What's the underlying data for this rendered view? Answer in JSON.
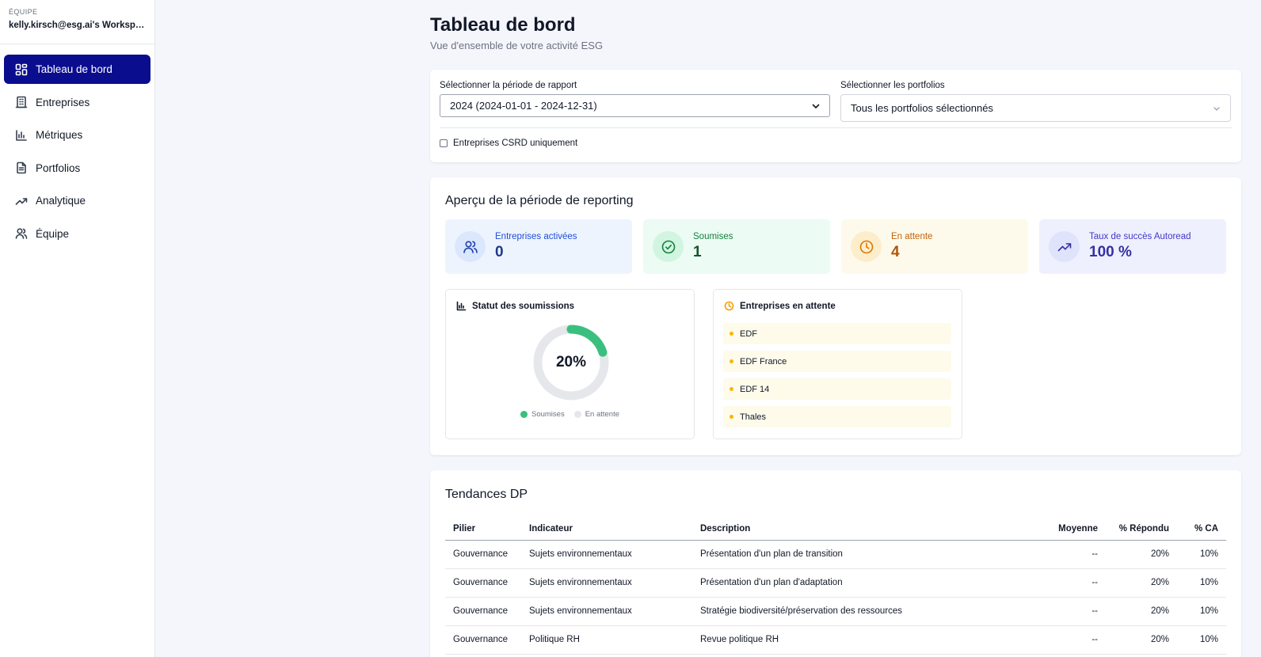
{
  "sidebar": {
    "team_caption": "ÉQUIPE",
    "team_name": "kelly.kirsch@esg.ai's Workspace",
    "items": [
      {
        "label": "Tableau de bord",
        "icon": "dashboard-icon"
      },
      {
        "label": "Entreprises",
        "icon": "building-icon"
      },
      {
        "label": "Métriques",
        "icon": "bar-chart-icon"
      },
      {
        "label": "Portfolios",
        "icon": "document-icon"
      },
      {
        "label": "Analytique",
        "icon": "trending-up-icon"
      },
      {
        "label": "Équipe",
        "icon": "users-icon"
      }
    ]
  },
  "header": {
    "title": "Tableau de bord",
    "subtitle": "Vue d'ensemble de votre activité ESG"
  },
  "filters": {
    "period_label": "Sélectionner la période de rapport",
    "period_value": "2024 (2024-01-01 - 2024-12-31)",
    "portfolio_label": "Sélectionner les portfolios",
    "portfolio_value": "Tous les portfolios sélectionnés",
    "csrd_label": "Entreprises CSRD uniquement",
    "csrd_checked": false
  },
  "overview": {
    "title": "Aperçu de la période de reporting",
    "stats": [
      {
        "label": "Entreprises activées",
        "value": "0",
        "icon": "users-icon",
        "color": "#1e40af",
        "bg": "#eef4fe"
      },
      {
        "label": "Soumises",
        "value": "1",
        "icon": "check-circle-icon",
        "color": "#166534",
        "bg": "#ecfbf3"
      },
      {
        "label": "En attente",
        "value": "4",
        "icon": "clock-icon",
        "color": "#b45309",
        "bg": "#fefaeb"
      },
      {
        "label": "Taux de succès Autoread",
        "value": "100 %",
        "icon": "trending-up-icon",
        "color": "#3730a3",
        "bg": "#eef0fd"
      }
    ],
    "submissions": {
      "title": "Statut des soumissions",
      "percent_label": "20%",
      "percent": 20,
      "legend": [
        "Soumises",
        "En attente"
      ],
      "colors": {
        "submitted": "#3bbf7f",
        "pending": "#e5e7eb"
      }
    },
    "pending": {
      "title": "Entreprises en attente",
      "items": [
        "EDF",
        "EDF France",
        "EDF 14",
        "Thales"
      ]
    }
  },
  "trends": {
    "title": "Tendances DP",
    "columns": [
      "Pilier",
      "Indicateur",
      "Description",
      "Moyenne",
      "% Répondu",
      "% CA"
    ],
    "rows": [
      [
        "Gouvernance",
        "Sujets environnementaux",
        "Présentation d'un plan de transition",
        "--",
        "20%",
        "10%"
      ],
      [
        "Gouvernance",
        "Sujets environnementaux",
        "Présentation d'un plan d'adaptation",
        "--",
        "20%",
        "10%"
      ],
      [
        "Gouvernance",
        "Sujets environnementaux",
        "Stratégie biodiversité/préservation des ressources",
        "--",
        "20%",
        "10%"
      ],
      [
        "Gouvernance",
        "Politique RH",
        "Revue politique RH",
        "--",
        "20%",
        "10%"
      ]
    ]
  }
}
